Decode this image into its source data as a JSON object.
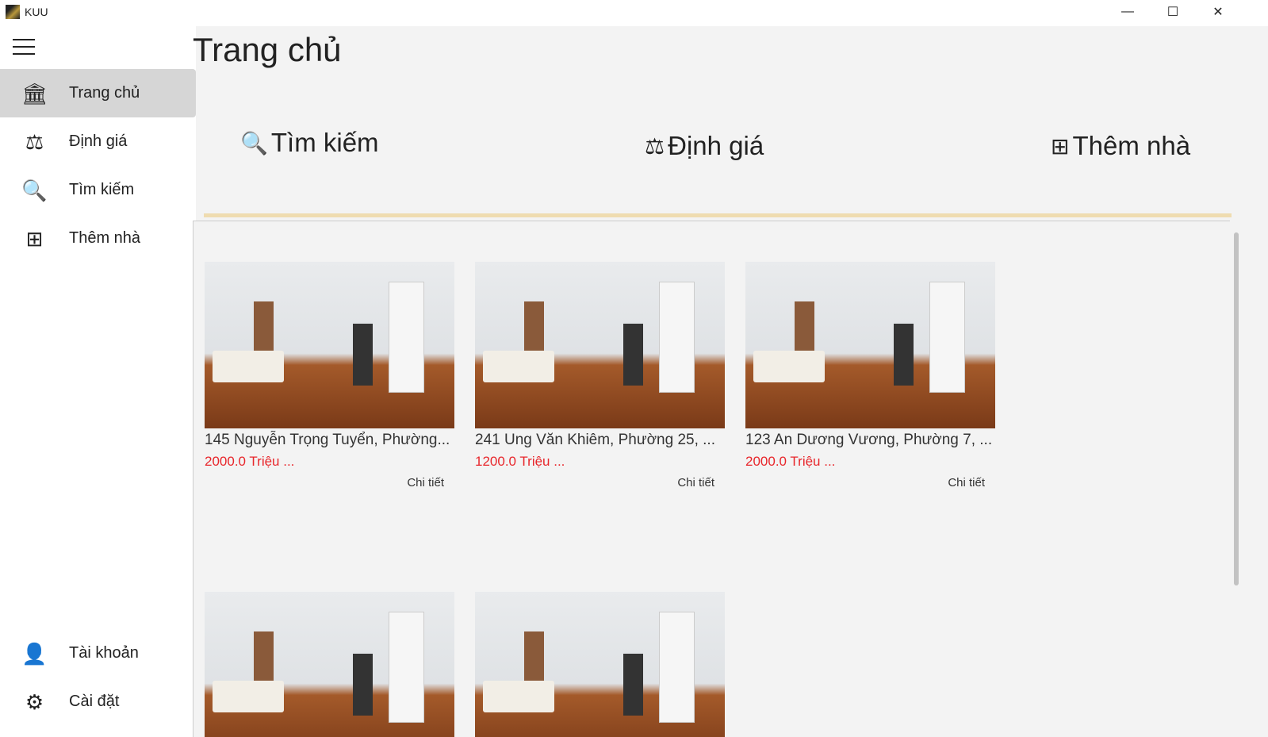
{
  "window": {
    "title": "KUU",
    "minimize": "—",
    "maximize": "☐",
    "close": "✕"
  },
  "sidebar": {
    "items": [
      {
        "label": "Trang chủ",
        "icon": "home-icon",
        "glyph": "🏛",
        "active": true
      },
      {
        "label": "Định giá",
        "icon": "scale-icon",
        "glyph": "⚖"
      },
      {
        "label": "Tìm kiếm",
        "icon": "search-list-icon",
        "glyph": "🔍"
      },
      {
        "label": "Thêm nhà",
        "icon": "add-house-icon",
        "glyph": "⊞"
      }
    ],
    "bottom": [
      {
        "label": "Tài khoản",
        "icon": "account-icon",
        "glyph": "👤"
      },
      {
        "label": "Cài đặt",
        "icon": "settings-icon",
        "glyph": "⚙"
      }
    ]
  },
  "page": {
    "title": "Trang chủ"
  },
  "quick_actions": [
    {
      "label": "Tìm kiếm",
      "glyph": "🔍"
    },
    {
      "label": "Định giá",
      "glyph": "⚖"
    },
    {
      "label": "Thêm nhà",
      "glyph": "⊞"
    }
  ],
  "listings": [
    {
      "address": "145 Nguyễn Trọng Tuyển, Phường...",
      "price": "2000.0 Triệu ...",
      "detail": "Chi tiết"
    },
    {
      "address": "241 Ung Văn Khiêm, Phường 25, ...",
      "price": "1200.0 Triệu ...",
      "detail": "Chi tiết"
    },
    {
      "address": "123 An Dương Vương, Phường 7, ...",
      "price": "2000.0 Triệu ...",
      "detail": "Chi tiết"
    },
    {},
    {}
  ],
  "colors": {
    "accent_line": "#efdcb0",
    "price": "#e8262b",
    "active_nav": "#d6d6d6"
  }
}
